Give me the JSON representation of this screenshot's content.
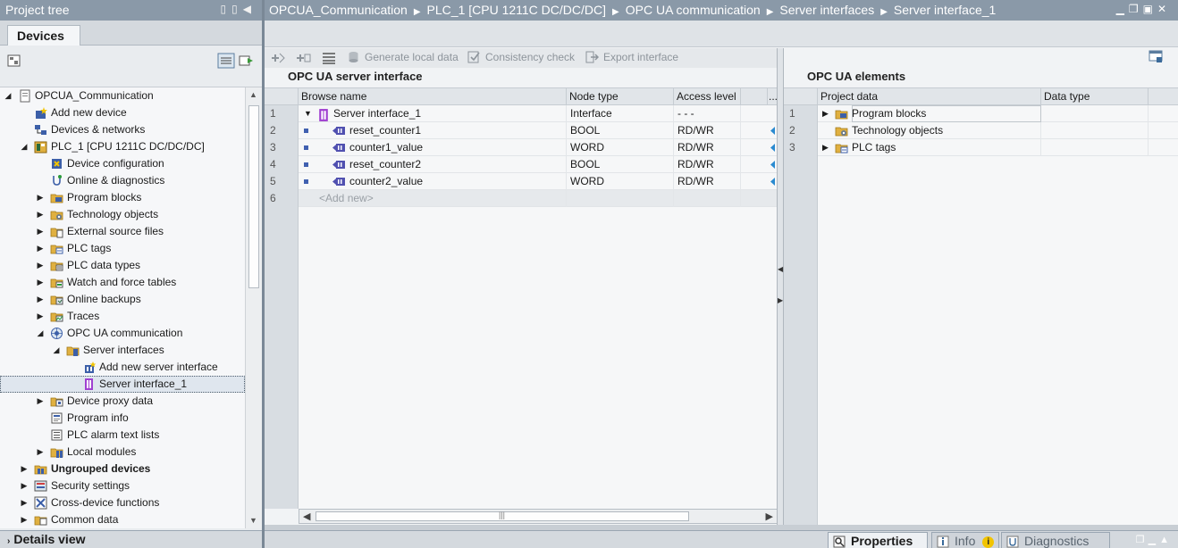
{
  "tree_panel": {
    "title": "Project tree",
    "tab": "Devices",
    "items": [
      {
        "label": "OPCUA_Communication",
        "indent": 0,
        "expand": "open",
        "icon": "project-icon"
      },
      {
        "label": "Add new device",
        "indent": 1,
        "expand": "none",
        "icon": "add-device-icon"
      },
      {
        "label": "Devices & networks",
        "indent": 1,
        "expand": "none",
        "icon": "devices-networks-icon"
      },
      {
        "label": "PLC_1 [CPU 1211C DC/DC/DC]",
        "indent": 1,
        "expand": "open",
        "icon": "plc-icon"
      },
      {
        "label": "Device configuration",
        "indent": 2,
        "expand": "none",
        "icon": "device-config-icon"
      },
      {
        "label": "Online & diagnostics",
        "indent": 2,
        "expand": "none",
        "icon": "online-diag-icon"
      },
      {
        "label": "Program blocks",
        "indent": 2,
        "expand": "closed",
        "icon": "folder-icon"
      },
      {
        "label": "Technology objects",
        "indent": 2,
        "expand": "closed",
        "icon": "folder-gear-icon"
      },
      {
        "label": "External source files",
        "indent": 2,
        "expand": "closed",
        "icon": "folder-file-icon"
      },
      {
        "label": "PLC tags",
        "indent": 2,
        "expand": "closed",
        "icon": "folder-tag-icon"
      },
      {
        "label": "PLC data types",
        "indent": 2,
        "expand": "closed",
        "icon": "folder-type-icon"
      },
      {
        "label": "Watch and force tables",
        "indent": 2,
        "expand": "closed",
        "icon": "folder-watch-icon"
      },
      {
        "label": "Online backups",
        "indent": 2,
        "expand": "closed",
        "icon": "folder-backup-icon"
      },
      {
        "label": "Traces",
        "indent": 2,
        "expand": "closed",
        "icon": "folder-trace-icon"
      },
      {
        "label": "OPC UA communication",
        "indent": 2,
        "expand": "open",
        "icon": "opcua-icon"
      },
      {
        "label": "Server interfaces",
        "indent": 3,
        "expand": "open",
        "icon": "folder-server-icon"
      },
      {
        "label": "Add new server interface",
        "indent": 4,
        "expand": "none",
        "icon": "add-interface-icon"
      },
      {
        "label": "Server interface_1",
        "indent": 4,
        "expand": "none",
        "icon": "interface-icon",
        "selected": true
      },
      {
        "label": "Device proxy data",
        "indent": 2,
        "expand": "closed",
        "icon": "folder-proxy-icon"
      },
      {
        "label": "Program info",
        "indent": 2,
        "expand": "none",
        "icon": "program-info-icon"
      },
      {
        "label": "PLC alarm text lists",
        "indent": 2,
        "expand": "none",
        "icon": "alarm-text-icon"
      },
      {
        "label": "Local modules",
        "indent": 2,
        "expand": "closed",
        "icon": "folder-modules-icon"
      },
      {
        "label": "Ungrouped devices",
        "indent": 1,
        "expand": "closed",
        "icon": "folder-devices-icon",
        "bold": true
      },
      {
        "label": "Security settings",
        "indent": 1,
        "expand": "closed",
        "icon": "security-icon"
      },
      {
        "label": "Cross-device functions",
        "indent": 1,
        "expand": "closed",
        "icon": "cross-device-icon"
      },
      {
        "label": "Common data",
        "indent": 1,
        "expand": "closed",
        "icon": "folder-common-icon"
      }
    ],
    "details_view": "Details view"
  },
  "editor": {
    "breadcrumb": [
      "OPCUA_Communication",
      "PLC_1 [CPU 1211C DC/DC/DC]",
      "OPC UA communication",
      "Server interfaces",
      "Server interface_1"
    ],
    "toolbar": {
      "generate": "Generate local data",
      "consistency": "Consistency check",
      "export": "Export interface"
    },
    "server_interface": {
      "title": "OPC UA server interface",
      "columns": [
        "Browse name",
        "Node type",
        "Access level",
        "..."
      ],
      "rows": [
        {
          "num": "1",
          "name": "Server interface_1",
          "type": "Interface",
          "access": "- - -",
          "kind": "interface"
        },
        {
          "num": "2",
          "name": "reset_counter1",
          "type": "BOOL",
          "access": "RD/WR",
          "kind": "var"
        },
        {
          "num": "3",
          "name": "counter1_value",
          "type": "WORD",
          "access": "RD/WR",
          "kind": "var"
        },
        {
          "num": "4",
          "name": "reset_counter2",
          "type": "BOOL",
          "access": "RD/WR",
          "kind": "var"
        },
        {
          "num": "5",
          "name": "counter2_value",
          "type": "WORD",
          "access": "RD/WR",
          "kind": "var"
        },
        {
          "num": "6",
          "name": "<Add new>",
          "type": "",
          "access": "",
          "kind": "add"
        }
      ]
    },
    "elements": {
      "title": "OPC UA elements",
      "columns": [
        "Project data",
        "Data type"
      ],
      "rows": [
        {
          "num": "1",
          "name": "Program blocks",
          "icon": "folder-icon",
          "expand": "closed"
        },
        {
          "num": "2",
          "name": "Technology objects",
          "icon": "folder-gear-icon",
          "expand": "none"
        },
        {
          "num": "3",
          "name": "PLC tags",
          "icon": "folder-tag-icon",
          "expand": "closed"
        }
      ]
    },
    "bottom_tabs": {
      "properties": "Properties",
      "info": "Info",
      "diagnostics": "Diagnostics"
    }
  },
  "colors": {
    "header_bar": "#8a99a8",
    "interface_icon": "#a040d0",
    "var_icon": "#5050b0",
    "folder": "#e0b040"
  }
}
